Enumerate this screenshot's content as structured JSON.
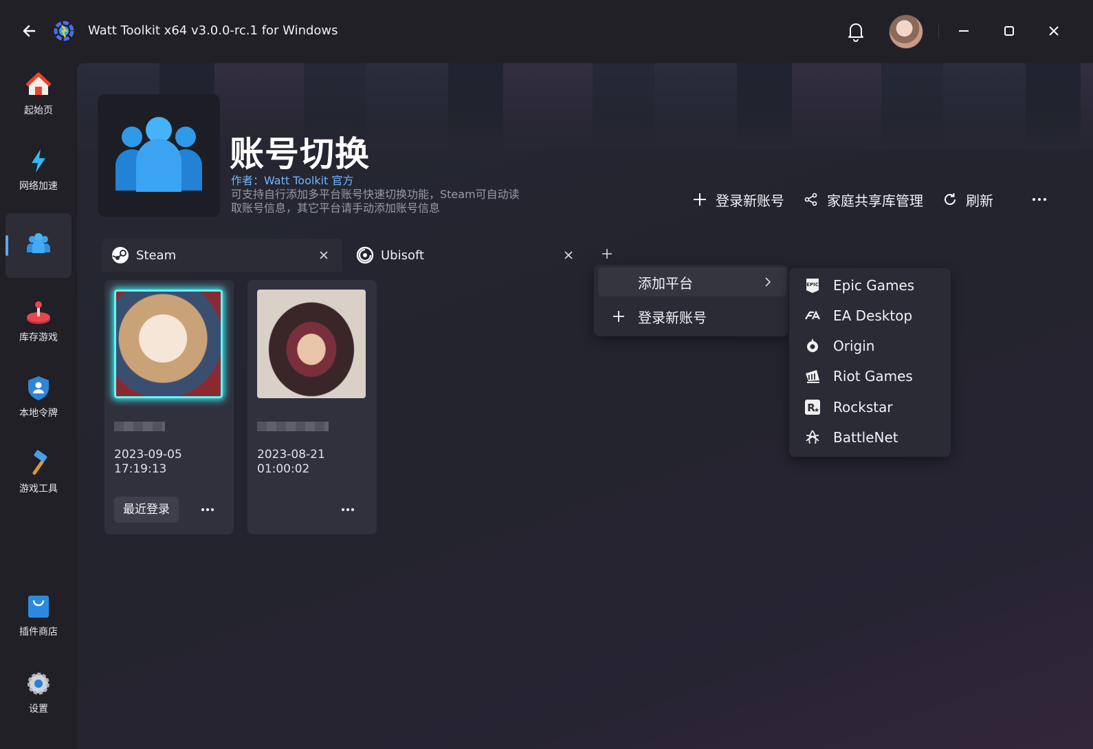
{
  "window": {
    "title": "Watt Toolkit x64 v3.0.0-rc.1 for Windows"
  },
  "sidebar": {
    "items": [
      {
        "label": "起始页"
      },
      {
        "label": "网络加速"
      },
      {
        "label": ""
      },
      {
        "label": "库存游戏"
      },
      {
        "label": "本地令牌"
      },
      {
        "label": "游戏工具"
      },
      {
        "label": "插件商店"
      },
      {
        "label": "设置"
      }
    ],
    "active_index": 2
  },
  "plugin": {
    "title": "账号切换",
    "author": "作者：Watt Toolkit  官方",
    "description": "可支持自行添加多平台账号快速切换功能，Steam可自动读取账号信息，其它平台请手动添加账号信息"
  },
  "actions": {
    "login_new": "登录新账号",
    "family_share": "家庭共享库管理",
    "refresh": "刷新"
  },
  "tabs": [
    {
      "label": "Steam",
      "icon": "steam-icon"
    },
    {
      "label": "Ubisoft",
      "icon": "ubisoft-icon"
    }
  ],
  "accounts": [
    {
      "date": "2023-09-05",
      "time": "17:19:13",
      "badge": "最近登录"
    },
    {
      "date": "2023-08-21",
      "time": "01:00:02",
      "badge": ""
    }
  ],
  "menu": {
    "add_platform": "添加平台",
    "login_new": "登录新账号"
  },
  "platforms": [
    {
      "label": "Epic Games",
      "icon": "epic-games-icon"
    },
    {
      "label": "EA Desktop",
      "icon": "ea-icon"
    },
    {
      "label": "Origin",
      "icon": "origin-icon"
    },
    {
      "label": "Riot Games",
      "icon": "riot-icon"
    },
    {
      "label": "Rockstar",
      "icon": "rockstar-icon"
    },
    {
      "label": "BattleNet",
      "icon": "battlenet-icon"
    }
  ],
  "colors": {
    "accent": "#5aa8ff",
    "author": "#6fb6ff",
    "glow": "#38e0e8"
  }
}
